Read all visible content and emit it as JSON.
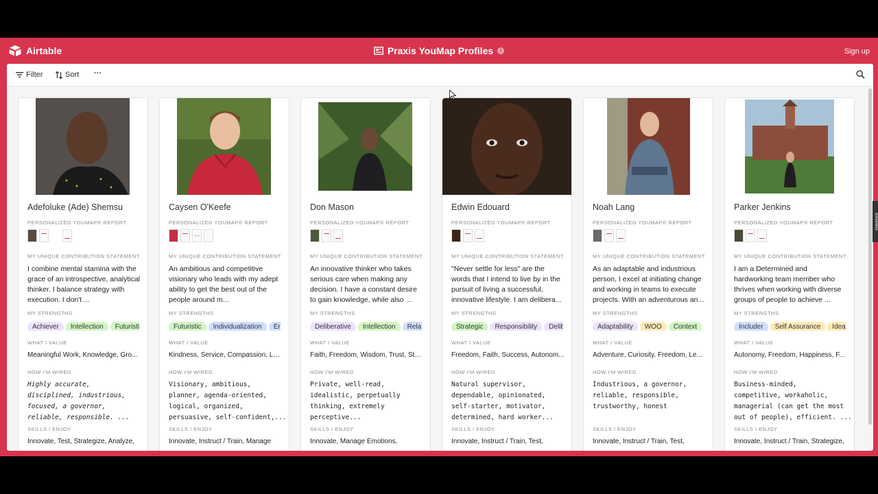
{
  "app": {
    "brand": "Airtable",
    "title": "Praxis YouMap Profiles",
    "signup": "Sign up"
  },
  "toolbar": {
    "filter": "Filter",
    "sort": "Sort",
    "more": "···"
  },
  "labels": {
    "report": "PERSONALIZED YOUMAP® REPORT",
    "statement": "MY UNIQUE CONTRIBUTION STATEMENT",
    "strengths": "MY STRENGTHS",
    "value": "WHAT I VALUE",
    "wired": "HOW I'M WIRED",
    "skills": "SKILLS I ENJOY"
  },
  "side_tab": "screenrec",
  "cards": [
    {
      "name": "Adefoluke (Ade) Shemsu",
      "statement": "I combine mental stamina with the grace of an introspective, analytical thinker. I balance strategy with execution. I don't ...",
      "strengths": [
        "Achiever",
        "Intellection",
        "Futuristi"
      ],
      "values": "Meaningful Work, Knowledge, Gro...",
      "wired": "Highly accurate,\ndisciplined, industrious,\nfocused, a governor,\nreliable, responsible. ...",
      "skills": "Innovate, Test, Strategize, Analyze,"
    },
    {
      "name": "Caysen O'Keefe",
      "statement": "An ambitious and competitive visionary who leads with my adept ability to get the best out of the people around m...",
      "strengths": [
        "Futuristic",
        "Individualization",
        "Em"
      ],
      "values": "Kindness, Service, Compassion, Le...",
      "wired": "Visionary, ambitious,\nplanner, agenda-oriented,\nlogical, organized,\npersuasive, self-confident,...",
      "skills": "Innovate, Instruct / Train, Manage"
    },
    {
      "name": "Don Mason",
      "statement": "An innovative thinker who takes serious care when making any decision. I have a constant desire to gain knowledge, while also ...",
      "strengths": [
        "Deliberative",
        "Intellection",
        "Relat"
      ],
      "values": "Faith, Freedom, Wisdom, Trust, Sta...",
      "wired": "Private, well-read,\nidealistic, perpetually\nthinking, extremely\nperceptive...",
      "skills": "Innovate, Manage Emotions,"
    },
    {
      "name": "Edwin Edouard",
      "statement": "\"Never settle for less\" are the words that I intend to live by in the pursuit of living a successful, innovative lifestyle. I am delibera...",
      "strengths": [
        "Strategic",
        "Responsibility",
        "Delib"
      ],
      "values": "Freedom, Faith, Success, Autonom...",
      "wired": "Natural supervisor,\ndependable, opinionated,\nself-starter, motivator,\ndetermined, hard worker...",
      "skills": "Innovate, Instruct / Train, Test,"
    },
    {
      "name": "Noah Lang",
      "statement": " As an adaptable and industrious person, I excel at initiating change and working in teams to execute projects. With an adventurous an...",
      "strengths": [
        "Adaptability",
        "WOO",
        "Context"
      ],
      "values": "Adventure, Curiosity, Freedom, Le...",
      "wired": "Industrious, a governor,\nreliable, responsible,\ntrustworthy, honest",
      "skills": "Innovate, Instruct / Train, Test,"
    },
    {
      "name": "Parker Jenkins",
      "statement": " I am a Determined and hardworking team member who thrives when working with diverse groups of people to achieve ...",
      "strengths": [
        "Includer",
        "Self Assurance",
        "Ideat"
      ],
      "values": "Autonomy, Freedom, Happiness, F...",
      "wired": "Business-minded,\ncompetitive, workaholic,\nmanagerial (can get the most\nout of people), efficient. ...",
      "skills": "Innovate, Instruct / Train, Strategize,"
    }
  ],
  "colors": {
    "brand_red": "#d7344d",
    "pill_palette": [
      "#d1f7c4",
      "#cfdfff",
      "#ede2fe",
      "#ffeab6",
      "#c2f5e9"
    ]
  }
}
